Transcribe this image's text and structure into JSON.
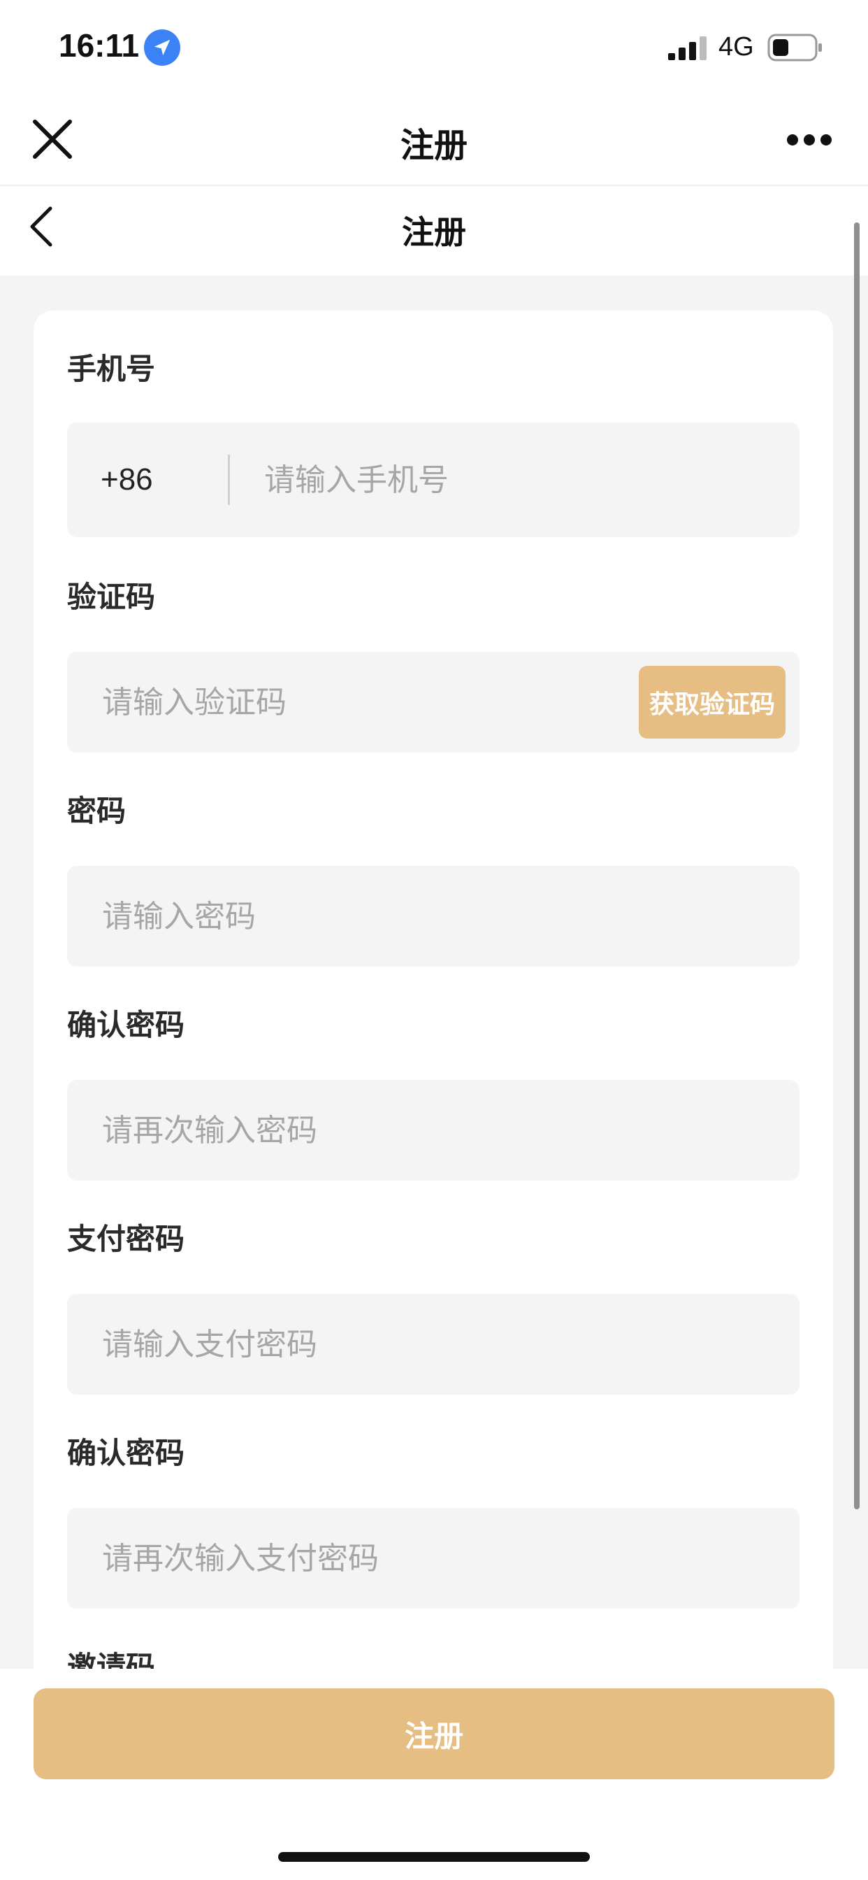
{
  "status_bar": {
    "time": "16:11",
    "network": "4G",
    "icons": [
      "location-arrow-icon",
      "signal-icon",
      "battery-icon"
    ]
  },
  "wechat_bar": {
    "title": "注册",
    "icons": [
      "close-icon",
      "more-icon"
    ]
  },
  "nav": {
    "title": "注册",
    "icons": [
      "back-icon"
    ]
  },
  "form": {
    "phone": {
      "label": "手机号",
      "country_code": "+86",
      "placeholder": "请输入手机号"
    },
    "verify_code": {
      "label": "验证码",
      "placeholder": "请输入验证码",
      "button": "获取验证码"
    },
    "password": {
      "label": "密码",
      "placeholder": "请输入密码"
    },
    "confirm_password": {
      "label": "确认密码",
      "placeholder": "请再次输入密码"
    },
    "pay_password": {
      "label": "支付密码",
      "placeholder": "请输入支付密码"
    },
    "confirm_pay_password": {
      "label": "确认密码",
      "placeholder": "请再次输入支付密码"
    },
    "invite_code": {
      "label": "邀请码"
    }
  },
  "bottom": {
    "register_label": "注册"
  },
  "colors": {
    "accent": "#e6be84",
    "background": "#f4f4f4",
    "field_bg": "#f4f4f4",
    "location": "#3b82f6"
  }
}
